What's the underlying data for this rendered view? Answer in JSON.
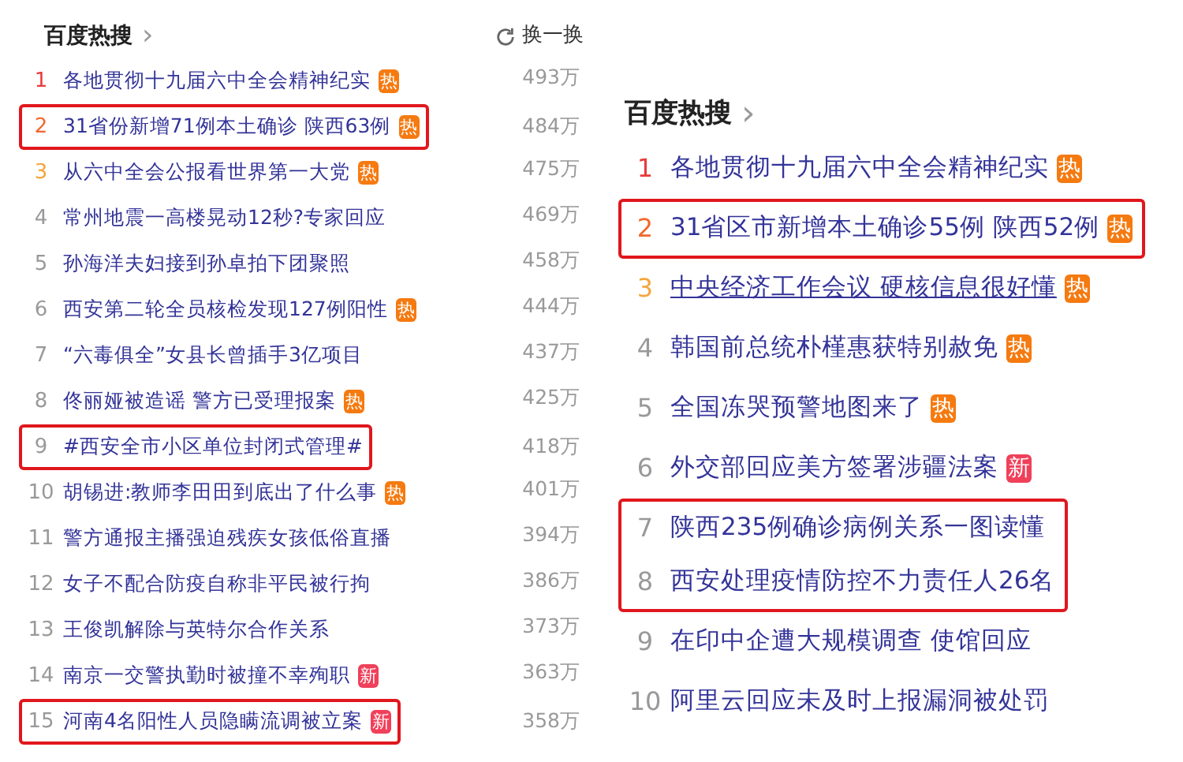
{
  "left": {
    "title": "百度热搜",
    "chevron": "›",
    "refresh": "换一换",
    "rows": [
      {
        "rank": "1",
        "color": "#e83b3b",
        "text": "各地贯彻十九届六中全会精神纪实",
        "badge": {
          "kind": "hot",
          "text": "热"
        },
        "count": "493万",
        "highlighted": false
      },
      {
        "rank": "2",
        "color": "#f0682d",
        "text": "31省份新增71例本土确诊 陕西63例",
        "badge": {
          "kind": "hot",
          "text": "热"
        },
        "count": "484万",
        "highlighted": true
      },
      {
        "rank": "3",
        "color": "#f4a53b",
        "text": "从六中全会公报看世界第一大党",
        "badge": {
          "kind": "hot",
          "text": "热"
        },
        "count": "475万",
        "highlighted": false
      },
      {
        "rank": "4",
        "color": "#999999",
        "text": "常州地震一高楼晃动12秒?专家回应",
        "count": "469万",
        "highlighted": false
      },
      {
        "rank": "5",
        "color": "#999999",
        "text": "孙海洋夫妇接到孙卓拍下团聚照",
        "count": "458万",
        "highlighted": false
      },
      {
        "rank": "6",
        "color": "#999999",
        "text": "西安第二轮全员核检发现127例阳性",
        "badge": {
          "kind": "hot",
          "text": "热"
        },
        "count": "444万",
        "highlighted": false
      },
      {
        "rank": "7",
        "color": "#999999",
        "text": "“六毒俱全”女县长曾插手3亿项目",
        "count": "437万",
        "highlighted": false
      },
      {
        "rank": "8",
        "color": "#999999",
        "text": "佟丽娅被造谣 警方已受理报案",
        "badge": {
          "kind": "hot",
          "text": "热"
        },
        "count": "425万",
        "highlighted": false
      },
      {
        "rank": "9",
        "color": "#999999",
        "text": "#西安全市小区单位封闭式管理#",
        "count": "418万",
        "highlighted": true
      },
      {
        "rank": "10",
        "color": "#999999",
        "text": "胡锡进:教师李田田到底出了什么事",
        "badge": {
          "kind": "hot",
          "text": "热"
        },
        "count": "401万",
        "highlighted": false
      },
      {
        "rank": "11",
        "color": "#999999",
        "text": "警方通报主播强迫残疾女孩低俗直播",
        "count": "394万",
        "highlighted": false
      },
      {
        "rank": "12",
        "color": "#999999",
        "text": "女子不配合防疫自称非平民被行拘",
        "count": "386万",
        "highlighted": false
      },
      {
        "rank": "13",
        "color": "#999999",
        "text": "王俊凯解除与英特尔合作关系",
        "count": "373万",
        "highlighted": false
      },
      {
        "rank": "14",
        "color": "#999999",
        "text": "南京一交警执勤时被撞不幸殉职",
        "badge": {
          "kind": "new",
          "text": "新"
        },
        "count": "363万",
        "highlighted": false
      },
      {
        "rank": "15",
        "color": "#999999",
        "text": "河南4名阳性人员隐瞒流调被立案",
        "badge": {
          "kind": "new",
          "text": "新"
        },
        "count": "358万",
        "highlighted": true
      }
    ]
  },
  "right": {
    "title": "百度热搜",
    "chevron": "›",
    "rows": [
      {
        "rank": "1",
        "color": "#e83b3b",
        "text": "各地贯彻十九届六中全会精神纪实",
        "badge": {
          "kind": "hot",
          "text": "热"
        },
        "highlighted": false,
        "underlined": false
      },
      {
        "rank": "2",
        "color": "#f0682d",
        "text": "31省区市新增本土确诊55例 陕西52例",
        "badge": {
          "kind": "hot",
          "text": "热"
        },
        "highlighted": true,
        "underlined": false
      },
      {
        "rank": "3",
        "color": "#f4a53b",
        "text": "中央经济工作会议 硬核信息很好懂",
        "badge": {
          "kind": "hot",
          "text": "热"
        },
        "highlighted": false,
        "underlined": true
      },
      {
        "rank": "4",
        "color": "#999999",
        "text": "韩国前总统朴槿惠获特别赦免",
        "badge": {
          "kind": "hot",
          "text": "热"
        },
        "highlighted": false,
        "underlined": false
      },
      {
        "rank": "5",
        "color": "#999999",
        "text": "全国冻哭预警地图来了",
        "badge": {
          "kind": "hot",
          "text": "热"
        },
        "highlighted": false,
        "underlined": false
      },
      {
        "rank": "6",
        "color": "#999999",
        "text": "外交部回应美方签署涉疆法案",
        "badge": {
          "kind": "new",
          "text": "新"
        },
        "highlighted": false,
        "underlined": false
      },
      {
        "rank": "7",
        "color": "#999999",
        "text": "陕西235例确诊病例关系一图读懂",
        "highlighted": true,
        "underlined": false
      },
      {
        "rank": "8",
        "color": "#999999",
        "text": "西安处理疫情防控不力责任人26名",
        "highlighted": true,
        "underlined": false
      },
      {
        "rank": "9",
        "color": "#999999",
        "text": "在印中企遭大规模调查 使馆回应",
        "highlighted": false,
        "underlined": false
      },
      {
        "rank": "10",
        "color": "#999999",
        "text": "阿里云回应未及时上报漏洞被处罚",
        "highlighted": false,
        "underlined": false
      }
    ]
  }
}
